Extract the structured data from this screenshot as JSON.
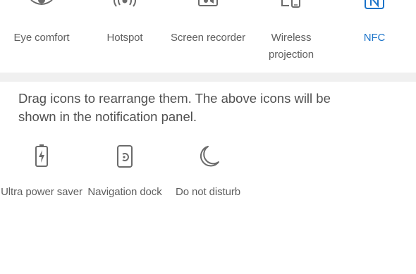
{
  "active_tiles": [
    {
      "label": "Eye comfort",
      "icon": "eye-icon",
      "active": false
    },
    {
      "label": "Hotspot",
      "icon": "hotspot-icon",
      "active": false
    },
    {
      "label": "Screen recorder",
      "icon": "screen-recorder-icon",
      "active": false
    },
    {
      "label": "Wireless projection",
      "icon": "wireless-projection-icon",
      "active": false
    },
    {
      "label": "NFC",
      "icon": "nfc-icon",
      "active": true
    }
  ],
  "hint_text": "Drag icons to rearrange them. The above icons will be shown in the notification panel.",
  "available_tiles": [
    {
      "label": "Ultra power saver",
      "icon": "battery-saver-icon"
    },
    {
      "label": "Navigation dock",
      "icon": "navigation-dock-icon"
    },
    {
      "label": "Do not disturb",
      "icon": "moon-icon"
    }
  ],
  "colors": {
    "active": "#1a73c9",
    "icon": "#6b6b6b",
    "label": "#5f5f5f",
    "divider": "#f0f0f0"
  }
}
